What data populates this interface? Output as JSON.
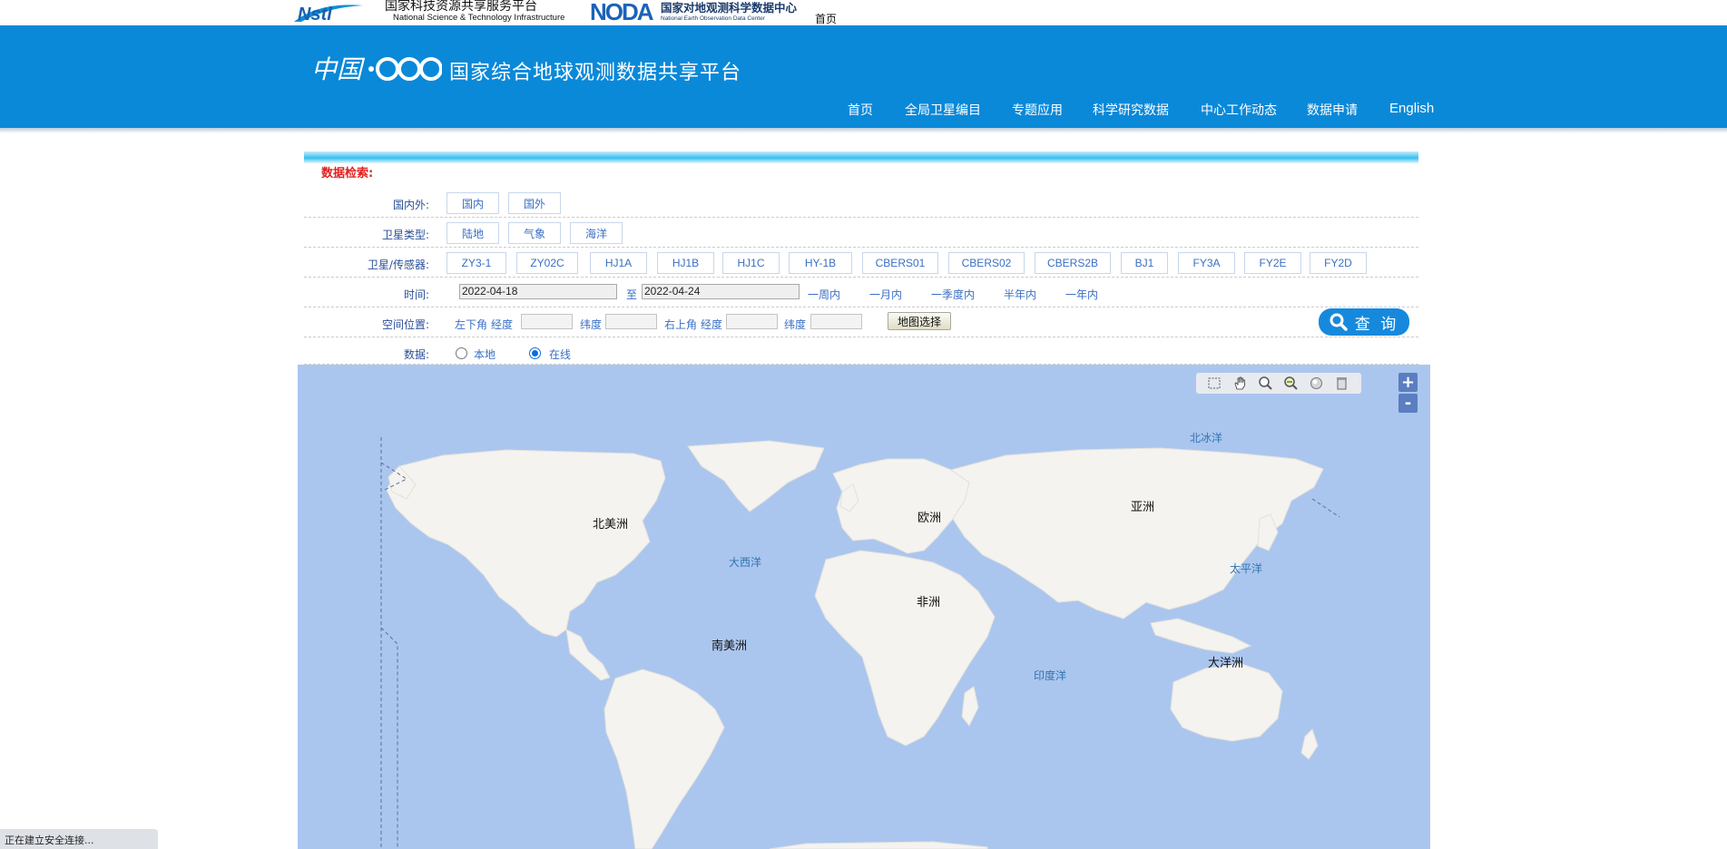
{
  "topbar": {
    "nstl_cn": "国家科技资源共享服务平台",
    "nstl_en": "National Science & Technology Infrastructure",
    "noda_cn": "国家对地观测科学数据中心",
    "noda_en": "National Earth Observation Data Center",
    "home": "首页"
  },
  "banner": {
    "title": "国家综合地球观测数据共享平台",
    "nav": [
      "首页",
      "全局卫星编目",
      "专题应用",
      "科学研究数据",
      "中心工作动态",
      "数据申请",
      "English"
    ]
  },
  "search": {
    "title": "数据检索:",
    "region_label": "国内外:",
    "region_options": [
      "国内",
      "国外"
    ],
    "sat_type_label": "卫星类型:",
    "sat_type_options": [
      "陆地",
      "气象",
      "海洋"
    ],
    "sensor_label": "卫星/传感器:",
    "sensor_options": [
      "ZY3-1",
      "ZY02C",
      "HJ1A",
      "HJ1B",
      "HJ1C",
      "HY-1B",
      "CBERS01",
      "CBERS02",
      "CBERS2B",
      "BJ1",
      "FY3A",
      "FY2E",
      "FY2D"
    ],
    "time_label": "时间:",
    "date_from": "2022-04-18",
    "date_to_sep": "至",
    "date_to": "2022-04-24",
    "time_shortcuts": [
      "一周内",
      "一月内",
      "一季度内",
      "半年内",
      "一年内"
    ],
    "space_label": "空间位置:",
    "lower_left": "左下角",
    "upper_right": "右上角",
    "lon": "经度",
    "lat": "纬度",
    "map_select": "地图选择",
    "data_label": "数据:",
    "data_options": [
      "本地",
      "在线"
    ],
    "data_selected": "在线",
    "query": "查 询"
  },
  "map": {
    "continents": [
      "北美洲",
      "欧洲",
      "亚洲",
      "非洲",
      "南美洲",
      "大洋洲"
    ],
    "oceans": [
      "北冰洋",
      "大西洋",
      "太平洋",
      "印度洋"
    ],
    "tools": [
      "zoom-box-icon",
      "pan-hand-icon",
      "zoom-in-icon",
      "zoom-out-icon",
      "full-extent-icon",
      "clear-icon"
    ],
    "zoom_in": "+",
    "zoom_out": "-"
  },
  "status": "正在建立安全连接..."
}
